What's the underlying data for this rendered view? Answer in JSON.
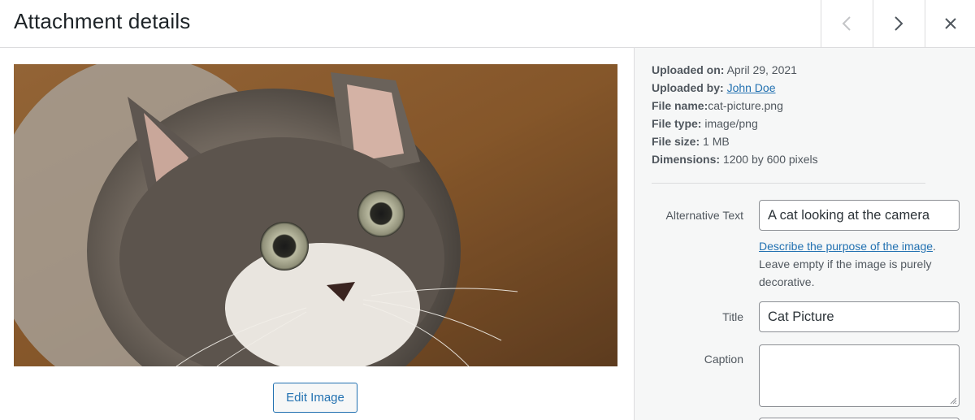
{
  "header": {
    "title": "Attachment details",
    "prev_icon": "chevron-left-icon",
    "next_icon": "chevron-right-icon",
    "close_icon": "close-icon"
  },
  "media": {
    "image_alt": "A cat looking at the camera",
    "edit_button_label": "Edit Image"
  },
  "details": {
    "uploaded_on_label": "Uploaded on:",
    "uploaded_on_value": "April 29, 2021",
    "uploaded_by_label": "Uploaded by:",
    "uploaded_by_value": "John Doe",
    "file_name_label": "File name:",
    "file_name_value": "cat-picture.png",
    "file_type_label": "File type:",
    "file_type_value": "image/png",
    "file_size_label": "File size:",
    "file_size_value": "1 MB",
    "dimensions_label": "Dimensions:",
    "dimensions_value": "1200 by 600 pixels"
  },
  "form": {
    "alt_text_label": "Alternative Text",
    "alt_text_value": "A cat looking at the camera",
    "alt_help_link": "Describe the purpose of the image",
    "alt_help_text": "Leave empty if the image is purely decorative.",
    "title_label": "Title",
    "title_value": "Cat Picture",
    "caption_label": "Caption",
    "caption_value": ""
  },
  "colors": {
    "accent": "#2271b1",
    "panel_bg": "#f6f7f7",
    "border": "#dcdcde",
    "muted_text": "#50575e"
  }
}
